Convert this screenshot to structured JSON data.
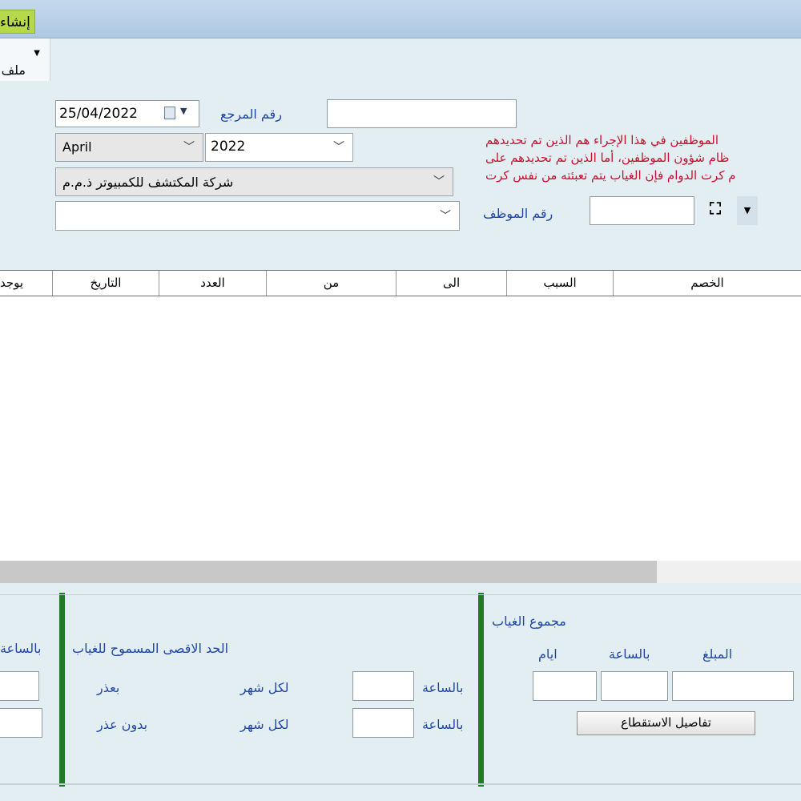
{
  "toolbar": {
    "create_label": "إنشاء",
    "file_menu_label": "ملف"
  },
  "header_form": {
    "date_value": "25/04/2022",
    "reference_label": "رقم المرجع",
    "reference_value": "",
    "month_value": "April",
    "year_value": "2022",
    "company_value": "شركة المكتشف للكمبيوتر ذ.م.م",
    "extra_combo_value": "",
    "employee_no_label": "رقم الموظف",
    "employee_no_value": "",
    "note_lines": [
      "الموظفين في هذا الإجراء هم الذين تم تحديدهم",
      "ظام شؤون الموظفين، أما الذين تم تحديدهم على",
      "م كرت الدوام فإن الغياب يتم تعبئته من نفس كرت"
    ]
  },
  "grid": {
    "columns": [
      "الخصم",
      "السبب",
      "الى",
      "من",
      "العدد",
      "التاريخ",
      "يوجد"
    ]
  },
  "absence_total": {
    "title": "مجموع الغياب",
    "amount_label": "المبلغ",
    "hourly_label": "بالساعة",
    "days_label": "ايام",
    "details_button": "تفاصيل الاستقطاع"
  },
  "max_allowed": {
    "title": "الحد الاقصى المسموح للغياب",
    "with_excuse_label": "بعذر",
    "without_excuse_label": "بدون عذر",
    "per_month_label_1": "لكل شهر",
    "per_month_label_2": "لكل شهر",
    "hourly_label_1": "بالساعة",
    "hourly_label_2": "بالساعة",
    "left_hourly_label": "بالساعة"
  },
  "colors": {
    "accent_green": "#1e7d22",
    "label_blue": "#1f46a8",
    "note_red": "#c8102e"
  }
}
